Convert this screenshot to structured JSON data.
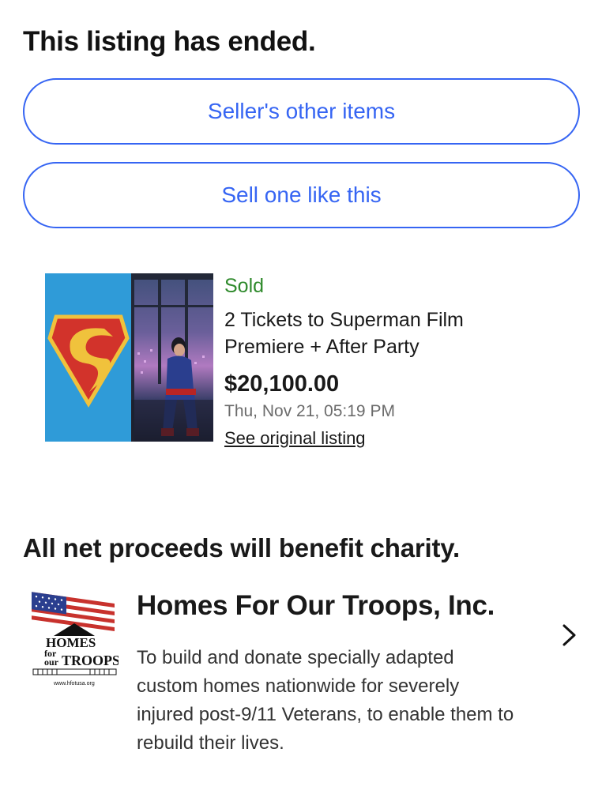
{
  "listing": {
    "status_heading": "This listing has ended.",
    "sellers_other_items_label": "Seller's other items",
    "sell_one_like_this_label": "Sell one like this"
  },
  "item": {
    "status": "Sold",
    "title": "2 Tickets to Superman Film Premiere + After Party",
    "price": "$20,100.00",
    "date": "Thu, Nov 21, 05:19 PM",
    "see_original_label": "See original listing",
    "image_icon": "superman-poster-image"
  },
  "charity": {
    "heading": "All net proceeds will benefit charity.",
    "name": "Homes For Our Troops, Inc.",
    "description": "To build and donate specially adapted custom homes nationwide for severely injured post-9/11 Veterans, to enable them to rebuild their lives.",
    "logo_text_line1": "HOMES",
    "logo_text_line2": "for",
    "logo_text_line3": "our",
    "logo_text_line4": "TROOPS",
    "logo_url_text": "www.hfotusa.org",
    "chevron_icon": "chevron-right-icon"
  },
  "colors": {
    "accent": "#3665f3",
    "sold_green": "#2f8a2c",
    "muted_text": "#6b6b6b"
  }
}
